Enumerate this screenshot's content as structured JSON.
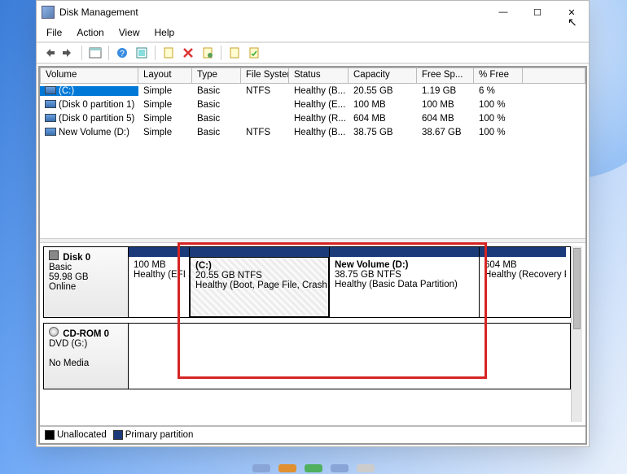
{
  "title": "Disk Management",
  "menubar": [
    "File",
    "Action",
    "View",
    "Help"
  ],
  "columns": [
    "Volume",
    "Layout",
    "Type",
    "File System",
    "Status",
    "Capacity",
    "Free Sp...",
    "% Free"
  ],
  "rows": [
    {
      "volume": "(C:)",
      "layout": "Simple",
      "type": "Basic",
      "fs": "NTFS",
      "status": "Healthy (B...",
      "capacity": "20.55 GB",
      "free": "1.19 GB",
      "pct": "6 %",
      "selected": true
    },
    {
      "volume": "(Disk 0 partition 1)",
      "layout": "Simple",
      "type": "Basic",
      "fs": "",
      "status": "Healthy (E...",
      "capacity": "100 MB",
      "free": "100 MB",
      "pct": "100 %",
      "selected": false
    },
    {
      "volume": "(Disk 0 partition 5)",
      "layout": "Simple",
      "type": "Basic",
      "fs": "",
      "status": "Healthy (R...",
      "capacity": "604 MB",
      "free": "604 MB",
      "pct": "100 %",
      "selected": false
    },
    {
      "volume": "New Volume (D:)",
      "layout": "Simple",
      "type": "Basic",
      "fs": "NTFS",
      "status": "Healthy (B...",
      "capacity": "38.75 GB",
      "free": "38.67 GB",
      "pct": "100 %",
      "selected": false
    }
  ],
  "disk0": {
    "label": "Disk 0",
    "type": "Basic",
    "size": "59.98 GB",
    "status": "Online",
    "parts": [
      {
        "name": "",
        "detail": "100 MB",
        "status": "Healthy (EFI S",
        "w": 75,
        "sel": false
      },
      {
        "name": "(C:)",
        "detail": "20.55 GB NTFS",
        "status": "Healthy (Boot, Page File, Crash Du",
        "w": 172,
        "sel": true
      },
      {
        "name": "New Volume  (D:)",
        "detail": "38.75 GB NTFS",
        "status": "Healthy (Basic Data Partition)",
        "w": 184,
        "sel": false
      },
      {
        "name": "",
        "detail": "604 MB",
        "status": "Healthy (Recovery Pa",
        "w": 106,
        "sel": false
      }
    ]
  },
  "cdrom": {
    "label": "CD-ROM 0",
    "sub": "DVD (G:)",
    "media": "No Media"
  },
  "legend": {
    "unallocated": "Unallocated",
    "primary": "Primary partition"
  },
  "winctl": {
    "min": "—",
    "max": "☐",
    "close": "✕"
  }
}
